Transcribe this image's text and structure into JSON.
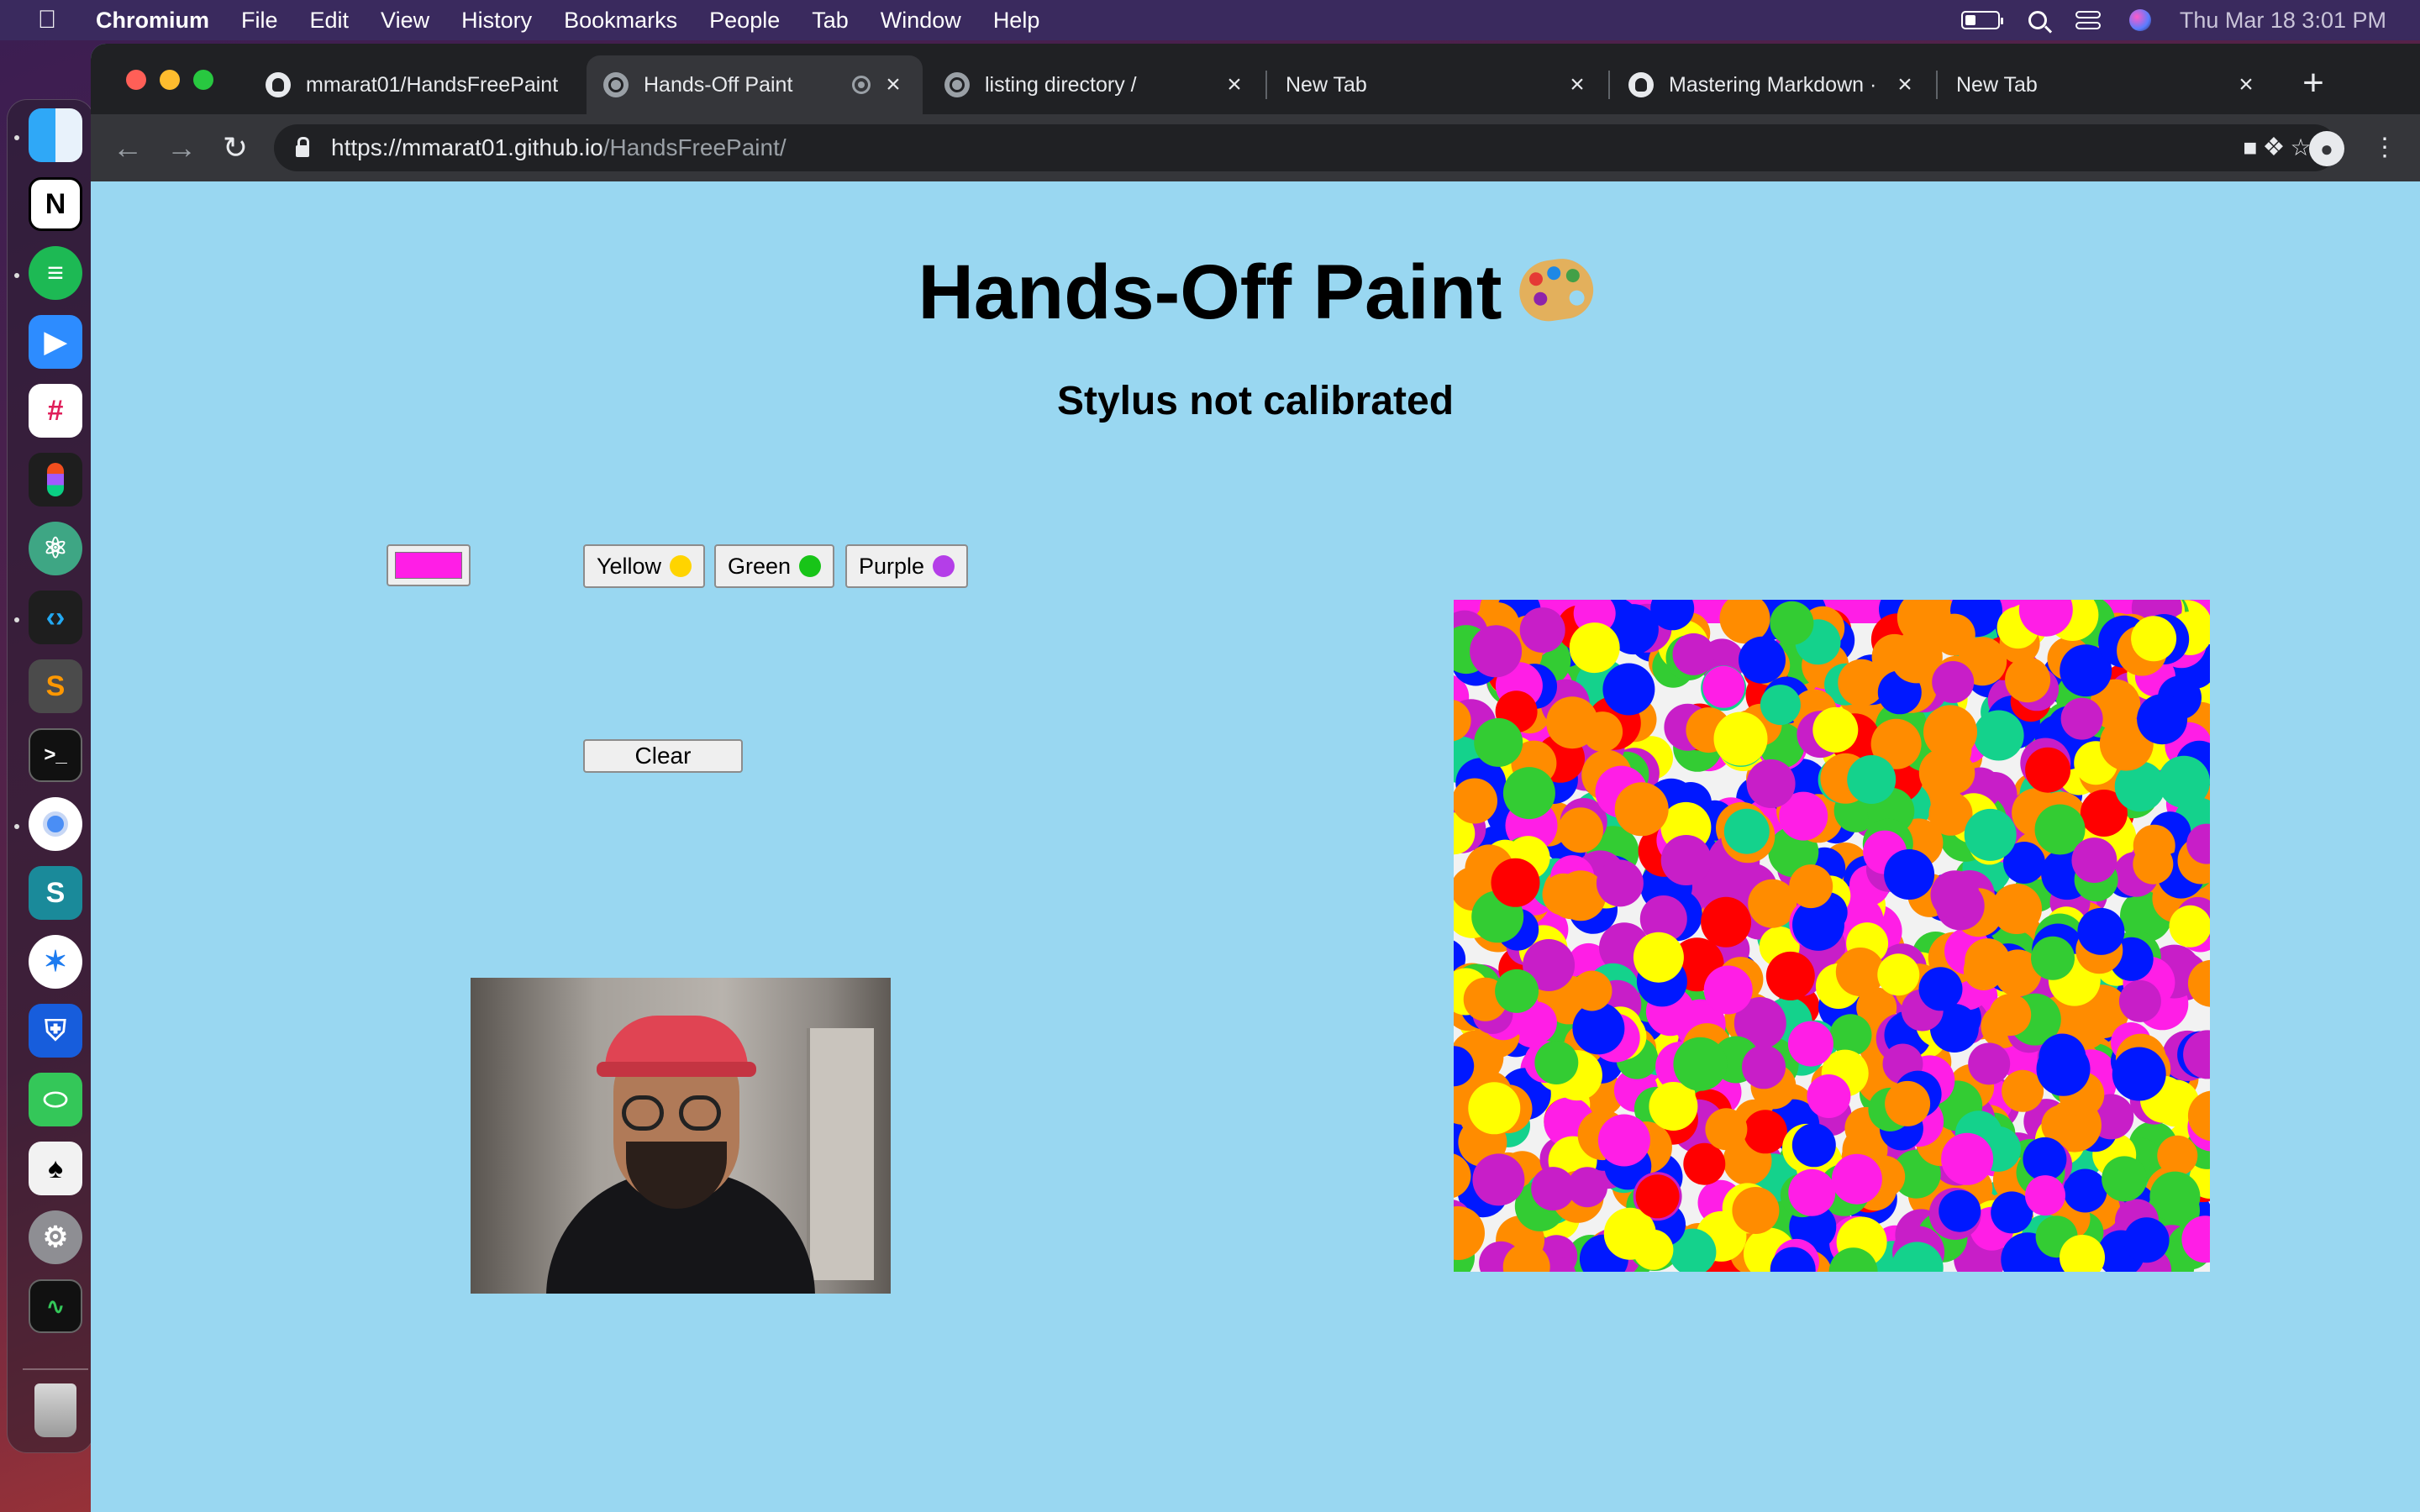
{
  "menubar": {
    "app_name": "Chromium",
    "items": [
      "File",
      "Edit",
      "View",
      "History",
      "Bookmarks",
      "People",
      "Tab",
      "Window",
      "Help"
    ],
    "datetime": "Thu Mar 18  3:01 PM",
    "status_icons": [
      "battery-icon",
      "spotlight-search-icon",
      "control-center-icon",
      "siri-icon"
    ]
  },
  "dock": {
    "apps": [
      "Finder",
      "Notion",
      "Spotify",
      "Zoom",
      "Slack",
      "Figma",
      "Atom",
      "Visual Studio Code",
      "Sublime Text",
      "Terminal",
      "Chromium",
      "Surfshark",
      "Safari",
      "Bitwarden",
      "Messages",
      "Poker",
      "System Preferences",
      "Activity Monitor",
      "Trash"
    ]
  },
  "tabs": [
    {
      "title": "mmarat01/HandsFreePaint",
      "icon": "github-icon"
    },
    {
      "title": "Hands-Off Paint",
      "icon": "globe-icon",
      "active": true
    },
    {
      "title": "listing directory /",
      "icon": "globe-icon"
    },
    {
      "title": "New Tab"
    },
    {
      "title": "Mastering Markdown · GitHub Guides",
      "icon": "github-icon"
    },
    {
      "title": "New Tab"
    }
  ],
  "address_bar": {
    "scheme_host": "https://mmarat01.github.io",
    "path": "/HandsFreePaint/"
  },
  "page": {
    "title": "Hands-Off Paint",
    "status": "Stylus not calibrated",
    "selected_color": "#ff1ee6",
    "color_buttons": [
      {
        "label": "Yellow",
        "color": "#ffd400"
      },
      {
        "label": "Green",
        "color": "#18c418"
      },
      {
        "label": "Purple",
        "color": "#b43ee8"
      }
    ],
    "clear_label": "Clear",
    "canvas_palette": [
      "#ff1ee6",
      "#ff8c00",
      "#0018ff",
      "#ffff00",
      "#33cc33",
      "#c81ec8",
      "#ff0000",
      "#14d28c"
    ]
  }
}
